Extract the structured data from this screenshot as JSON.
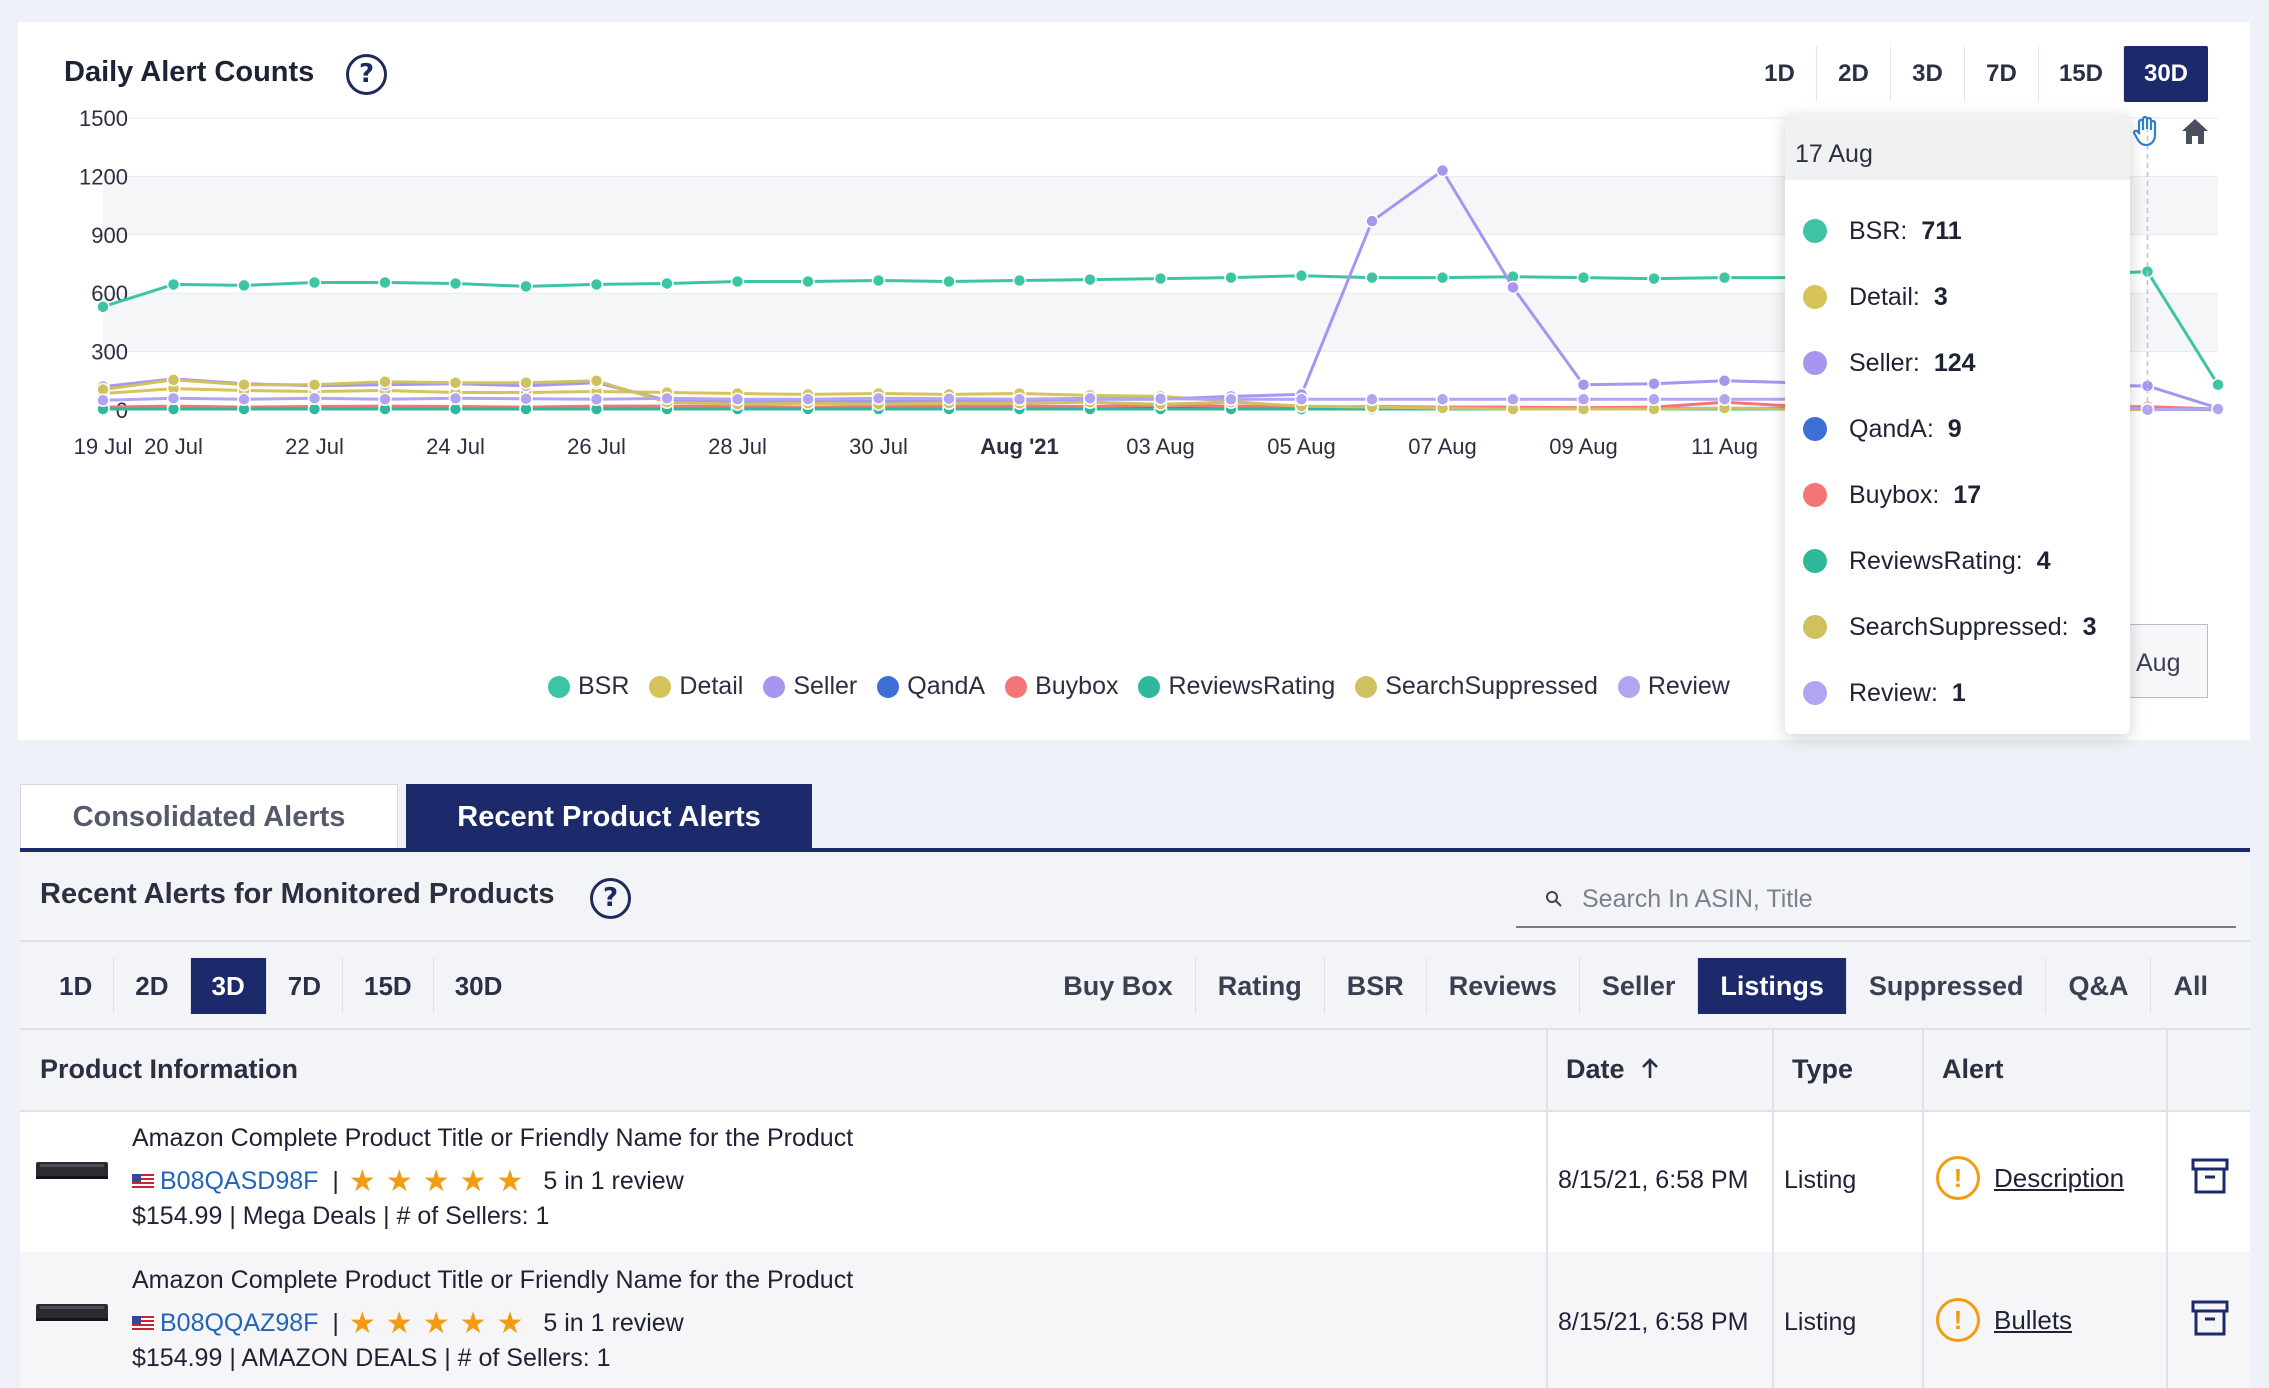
{
  "chart_card": {
    "title": "Daily Alert Counts",
    "range_buttons": [
      "1D",
      "2D",
      "3D",
      "7D",
      "15D",
      "30D"
    ],
    "active_range": "30D"
  },
  "chart_data": {
    "type": "line",
    "title": "Daily Alert Counts",
    "ylim": [
      0,
      1500
    ],
    "yticks": [
      0,
      300,
      600,
      900,
      1200,
      1500
    ],
    "grid": true,
    "legend_position": "bottom",
    "x": [
      "19 Jul",
      "20 Jul",
      "21 Jul",
      "22 Jul",
      "23 Jul",
      "24 Jul",
      "25 Jul",
      "26 Jul",
      "27 Jul",
      "28 Jul",
      "29 Jul",
      "30 Jul",
      "31 Jul",
      "01 Aug",
      "02 Aug",
      "03 Aug",
      "04 Aug",
      "05 Aug",
      "06 Aug",
      "07 Aug",
      "08 Aug",
      "09 Aug",
      "10 Aug",
      "11 Aug",
      "12 Aug",
      "13 Aug",
      "14 Aug",
      "15 Aug",
      "16 Aug",
      "17 Aug",
      "18 Aug"
    ],
    "xtick_labels": [
      "19 Jul",
      "20 Jul",
      "22 Jul",
      "24 Jul",
      "26 Jul",
      "28 Jul",
      "30 Jul",
      "Aug '21",
      "03 Aug",
      "05 Aug",
      "07 Aug",
      "09 Aug",
      "11 Aug",
      "Aug"
    ],
    "series": [
      {
        "name": "BSR",
        "color": "#3cc4a5",
        "values": [
          530,
          645,
          640,
          655,
          655,
          650,
          635,
          645,
          650,
          660,
          660,
          665,
          660,
          665,
          670,
          675,
          680,
          690,
          680,
          680,
          685,
          680,
          675,
          680,
          680,
          690,
          690,
          690,
          695,
          711,
          130
        ]
      },
      {
        "name": "Detail",
        "color": "#d6c35a",
        "values": [
          85,
          110,
          100,
          95,
          100,
          90,
          90,
          95,
          90,
          85,
          80,
          85,
          80,
          85,
          75,
          70,
          45,
          15,
          10,
          5,
          10,
          5,
          5,
          5,
          5,
          5,
          5,
          5,
          5,
          3,
          5
        ]
      },
      {
        "name": "Seller",
        "color": "#a895f0",
        "values": [
          120,
          160,
          135,
          125,
          130,
          135,
          125,
          140,
          50,
          45,
          45,
          45,
          45,
          50,
          55,
          55,
          70,
          80,
          970,
          1230,
          630,
          130,
          135,
          150,
          140,
          130,
          130,
          130,
          125,
          124,
          10
        ]
      },
      {
        "name": "QandA",
        "color": "#3d6fd6",
        "values": [
          5,
          10,
          10,
          8,
          8,
          8,
          8,
          8,
          8,
          8,
          8,
          8,
          8,
          8,
          8,
          8,
          8,
          8,
          8,
          8,
          8,
          8,
          8,
          8,
          8,
          8,
          8,
          8,
          8,
          9,
          2
        ]
      },
      {
        "name": "Buybox",
        "color": "#f47575",
        "values": [
          15,
          20,
          15,
          18,
          20,
          18,
          15,
          20,
          20,
          18,
          15,
          18,
          20,
          20,
          18,
          25,
          20,
          15,
          18,
          15,
          15,
          12,
          15,
          40,
          20,
          18,
          18,
          18,
          18,
          17,
          5
        ]
      },
      {
        "name": "ReviewsRating",
        "color": "#2fb89a",
        "values": [
          5,
          5,
          5,
          5,
          5,
          5,
          5,
          5,
          5,
          5,
          5,
          5,
          5,
          5,
          5,
          5,
          5,
          5,
          5,
          5,
          5,
          5,
          5,
          5,
          5,
          5,
          5,
          5,
          5,
          4,
          1
        ]
      },
      {
        "name": "SearchSuppressed",
        "color": "#cfc160",
        "values": [
          105,
          155,
          130,
          130,
          145,
          140,
          140,
          150,
          40,
          30,
          35,
          30,
          35,
          35,
          40,
          30,
          40,
          20,
          15,
          10,
          5,
          5,
          5,
          10,
          5,
          5,
          5,
          5,
          5,
          3,
          5
        ]
      },
      {
        "name": "Review",
        "color": "#b3a4f2",
        "values": [
          50,
          60,
          55,
          60,
          55,
          60,
          58,
          55,
          60,
          55,
          55,
          60,
          58,
          55,
          60,
          58,
          55,
          55,
          55,
          55,
          55,
          55,
          55,
          55,
          55,
          55,
          55,
          55,
          55,
          1,
          5
        ]
      }
    ]
  },
  "tooltip": {
    "date": "17 Aug",
    "rows": [
      {
        "label": "BSR:",
        "value": "711",
        "color": "#3cc4a5"
      },
      {
        "label": "Detail:",
        "value": "3",
        "color": "#d6c35a"
      },
      {
        "label": "Seller:",
        "value": "124",
        "color": "#a895f0"
      },
      {
        "label": "QandA:",
        "value": "9",
        "color": "#3d6fd6"
      },
      {
        "label": "Buybox:",
        "value": "17",
        "color": "#f47575"
      },
      {
        "label": "ReviewsRating:",
        "value": "4",
        "color": "#2fb89a"
      },
      {
        "label": "SearchSuppressed:",
        "value": "3",
        "color": "#cfc160"
      },
      {
        "label": "Review:",
        "value": "1",
        "color": "#b3a4f2"
      }
    ]
  },
  "tabs": {
    "consolidated": "Consolidated Alerts",
    "recent": "Recent Product Alerts",
    "active": "recent"
  },
  "panel": {
    "title": "Recent Alerts for Monitored Products",
    "search_placeholder": "Search In ASIN, Title",
    "day_buttons": [
      "1D",
      "2D",
      "3D",
      "7D",
      "15D",
      "30D"
    ],
    "active_day": "3D",
    "filter_buttons": [
      "Buy Box",
      "Rating",
      "BSR",
      "Reviews",
      "Seller",
      "Listings",
      "Suppressed",
      "Q&A",
      "All"
    ],
    "active_filter": "Listings"
  },
  "table": {
    "headers": {
      "product": "Product Information",
      "date": "Date",
      "type": "Type",
      "alert": "Alert"
    },
    "rows": [
      {
        "title": "Amazon Complete Product Title or Friendly Name for the Product",
        "asin": "B08QASD98F",
        "separator": "|",
        "stars": "★★★★★",
        "reviews": "5 in 1 review",
        "price_line": "$154.99 | Mega Deals |  # of Sellers: 1",
        "date": "8/15/21, 6:58 PM",
        "type": "Listing",
        "alert": "Description"
      },
      {
        "title": "Amazon Complete Product Title or Friendly Name for the Product",
        "asin": "B08QQAZ98F",
        "separator": "|",
        "stars": "★★★★★",
        "reviews": "5 in 1 review",
        "price_line": "$154.99 | AMAZON DEALS |  # of Sellers: 1",
        "date": "8/15/21, 6:58 PM",
        "type": "Listing",
        "alert": "Bullets"
      }
    ]
  }
}
